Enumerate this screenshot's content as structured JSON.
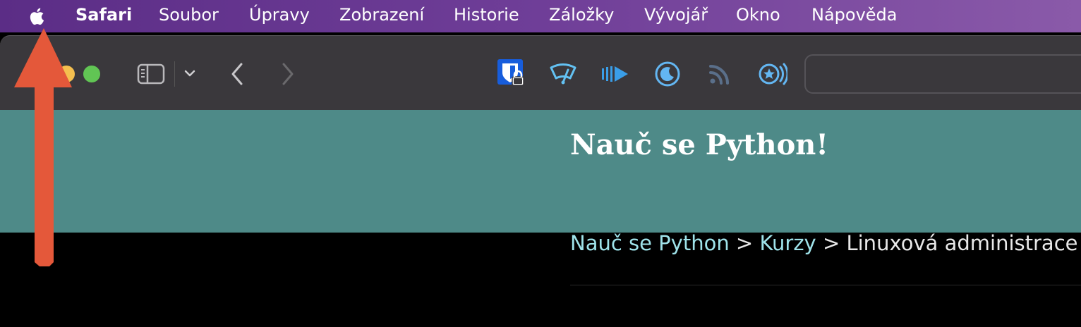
{
  "menubar": {
    "apple_icon": "apple-icon",
    "items": [
      {
        "label": "Safari",
        "bold": true
      },
      {
        "label": "Soubor"
      },
      {
        "label": "Úpravy"
      },
      {
        "label": "Zobrazení"
      },
      {
        "label": "Historie"
      },
      {
        "label": "Záložky"
      },
      {
        "label": "Vývojář"
      },
      {
        "label": "Okno"
      },
      {
        "label": "Nápověda"
      }
    ]
  },
  "toolbar": {
    "traffic_lights": [
      "close",
      "minimize",
      "zoom"
    ],
    "icons": [
      "sidebar-icon",
      "chevron-down-icon",
      "back-icon",
      "forward-icon"
    ],
    "extensions": [
      "bitwarden-icon",
      "wipr-icon",
      "play-forward-icon",
      "night-eye-icon",
      "rss-icon",
      "star-radio-icon"
    ],
    "address": ""
  },
  "page": {
    "hero_title": "Nauč se Python!",
    "breadcrumb": {
      "items": [
        "Nauč se Python",
        "Kurzy",
        "Linuxová administrace"
      ],
      "separator": ">"
    }
  },
  "colors": {
    "menubar": "#6f3e98",
    "hero": "#4e8a88",
    "link": "#9fe3ea",
    "annotation_arrow": "#e4583a"
  }
}
